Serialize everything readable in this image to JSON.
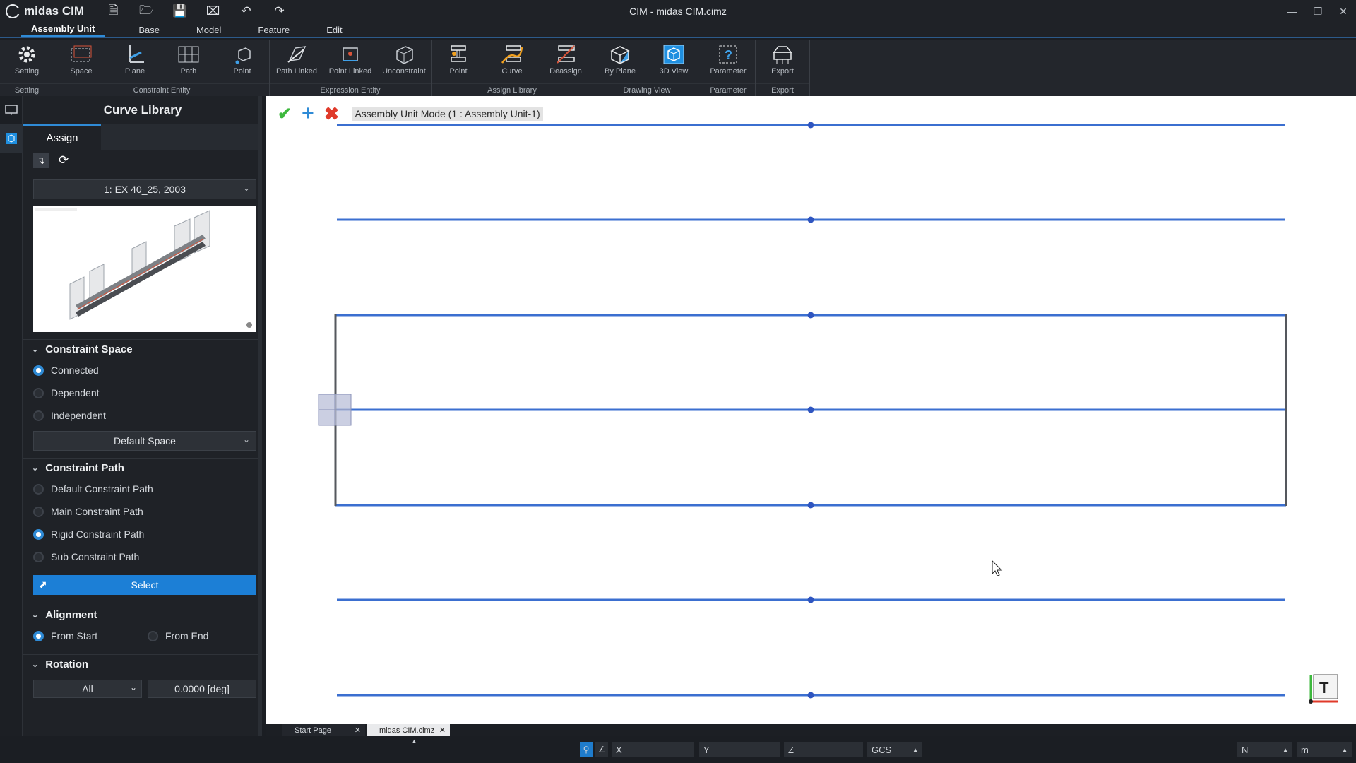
{
  "app": {
    "name": "midas CIM",
    "window_title": "CIM - midas CIM.cimz"
  },
  "quick_access": [
    "new-file",
    "open",
    "save",
    "close-file",
    "undo",
    "redo"
  ],
  "menu": {
    "tabs": [
      "Assembly Unit",
      "Base",
      "Model",
      "Feature",
      "Edit"
    ]
  },
  "ribbon": {
    "groups": [
      {
        "label": "Setting",
        "buttons": [
          "Setting"
        ]
      },
      {
        "label": "Constraint Entity",
        "buttons": [
          "Space",
          "Plane",
          "Path",
          "Point"
        ]
      },
      {
        "label": "Expression Entity",
        "buttons": [
          "Path Linked",
          "Point Linked",
          "Unconstraint"
        ]
      },
      {
        "label": "Assign Library",
        "buttons": [
          "Point",
          "Curve",
          "Deassign"
        ]
      },
      {
        "label": "Drawing View",
        "buttons": [
          "By Plane",
          "3D View"
        ]
      },
      {
        "label": "Parameter",
        "buttons": [
          "Parameter"
        ]
      },
      {
        "label": "Export",
        "buttons": [
          "Export"
        ]
      }
    ]
  },
  "panel": {
    "title": "Curve Library",
    "tab": "Assign",
    "library_select": "1: EX 40_25, 2003",
    "constraint_space": {
      "title": "Constraint Space",
      "options": [
        "Connected",
        "Dependent",
        "Independent"
      ],
      "selected": "Connected",
      "space_select": "Default Space"
    },
    "constraint_path": {
      "title": "Constraint Path",
      "options": [
        "Default Constraint Path",
        "Main Constraint Path",
        "Rigid Constraint Path",
        "Sub Constraint Path"
      ],
      "selected": "Rigid Constraint Path",
      "select_button": "Select"
    },
    "alignment": {
      "title": "Alignment",
      "from_start": "From Start",
      "from_end": "From End",
      "selected": "From Start"
    },
    "rotation": {
      "title": "Rotation",
      "mode": "All",
      "value": "0.0000 [deg]"
    }
  },
  "viewport": {
    "mode_label": "Assembly Unit Mode (1 : Assembly Unit-1)",
    "view_cube": "T"
  },
  "doc_tabs": [
    "Start Page",
    "midas CIM.cimz"
  ],
  "status": {
    "x_label": "X",
    "y_label": "Y",
    "z_label": "Z",
    "coord_system": "GCS",
    "force_unit": "N",
    "length_unit": "m"
  },
  "colors": {
    "accent": "#1c7fd6",
    "line": "#3b6fd0"
  }
}
